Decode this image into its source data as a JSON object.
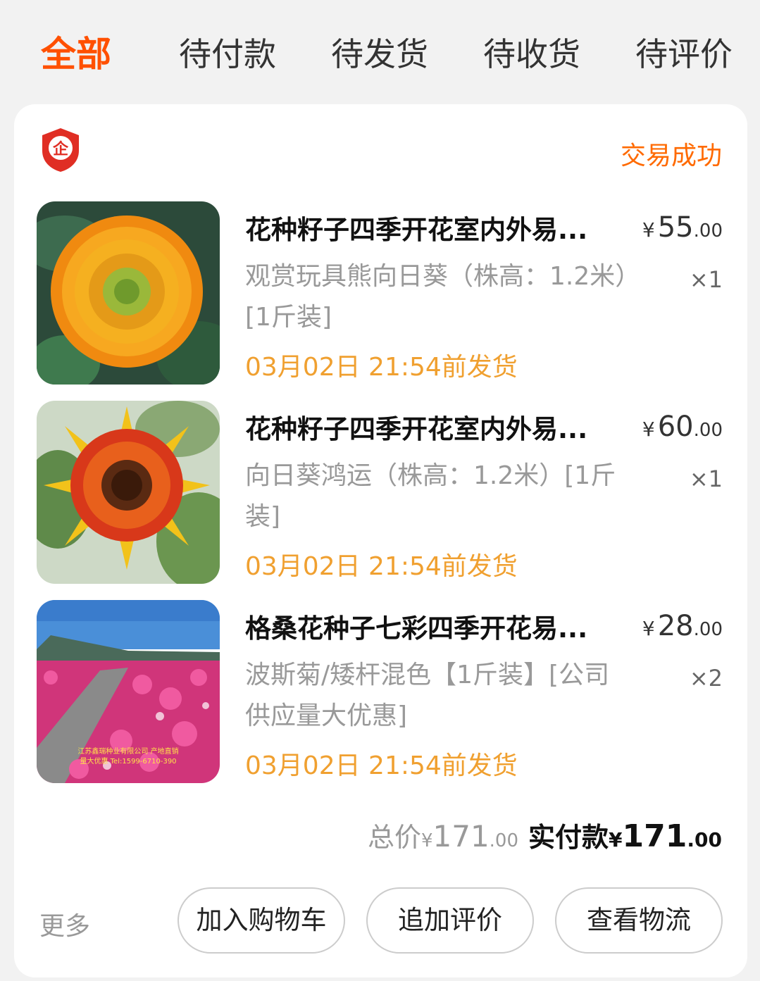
{
  "tabs": [
    {
      "label": "全部",
      "active": true
    },
    {
      "label": "待付款",
      "active": false
    },
    {
      "label": "待发货",
      "active": false
    },
    {
      "label": "待收货",
      "active": false
    },
    {
      "label": "待评价",
      "active": false
    }
  ],
  "order": {
    "shop_badge_icon": "enterprise-shield-icon",
    "shop_badge_text": "企",
    "status": "交易成功",
    "items": [
      {
        "title": "花种籽子四季开花室内外易...",
        "price_symbol": "¥",
        "price_int": "55",
        "price_dec": ".00",
        "spec": "观赏玩具熊向日葵（株高：1.2米）[1斤装]",
        "qty": "×1",
        "ship": "03月02日 21:54前发货",
        "image": "teddy-bear-sunflower-photo"
      },
      {
        "title": "花种籽子四季开花室内外易...",
        "price_symbol": "¥",
        "price_int": "60",
        "price_dec": ".00",
        "spec": "向日葵鸿运（株高：1.2米）[1斤装]",
        "qty": "×1",
        "ship": "03月02日 21:54前发货",
        "image": "red-sunflower-photo"
      },
      {
        "title": "格桑花种子七彩四季开花易...",
        "price_symbol": "¥",
        "price_int": "28",
        "price_dec": ".00",
        "spec": "波斯菊/矮杆混色【1斤装】[公司供应量大优惠]",
        "qty": "×2",
        "ship": "03月02日 21:54前发货",
        "image": "cosmos-flower-field-photo",
        "image_caption_1": "江苏鑫瑞种业有限公司 产地直销",
        "image_caption_2": "量大优惠 Tel:1599-6710-390"
      }
    ],
    "total_label": "总价",
    "total_symbol": "¥",
    "total_int": "171",
    "total_dec": ".00",
    "paid_label": "实付款",
    "paid_symbol": "¥",
    "paid_int": "171",
    "paid_dec": ".00",
    "more_label": "更多",
    "buttons": [
      "加入购物车",
      "追加评价",
      "查看物流"
    ]
  },
  "colors": {
    "accent": "#ff5000",
    "status": "#ff6a00",
    "ship": "#f0a030",
    "badge_red": "#e02e24"
  }
}
